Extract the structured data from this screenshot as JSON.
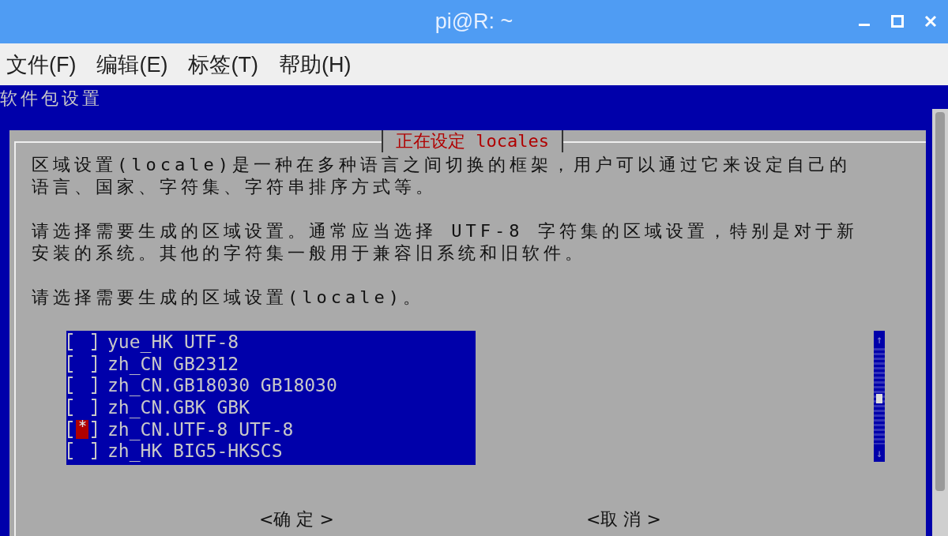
{
  "window": {
    "title": "pi@R: ~"
  },
  "menu": [
    "文件(F)",
    "编辑(E)",
    "标签(T)",
    "帮助(H)"
  ],
  "terminal": {
    "backtitle": "软件包设置"
  },
  "dialog": {
    "title": "正在设定 locales",
    "paragraphs": [
      "区域设置(locale)是一种在多种语言之间切换的框架，用户可以通过它来设定自己的语言、国家、字符集、字符串排序方式等。",
      "请选择需要生成的区域设置。通常应当选择 UTF-8 字符集的区域设置，特别是对于新安装的系统。其他的字符集一般用于兼容旧系统和旧软件。",
      "请选择需要生成的区域设置(locale)。"
    ],
    "items": [
      {
        "label": "yue_HK UTF-8",
        "checked": false
      },
      {
        "label": "zh_CN GB2312",
        "checked": false
      },
      {
        "label": "zh_CN.GB18030 GB18030",
        "checked": false
      },
      {
        "label": "zh_CN.GBK GBK",
        "checked": false
      },
      {
        "label": "zh_CN.UTF-8 UTF-8",
        "checked": true
      },
      {
        "label": "zh_HK BIG5-HKSCS",
        "checked": false
      }
    ],
    "scroll_up": "↑",
    "scroll_down": "↓",
    "buttons": [
      "<确 定 >",
      "<取 消 >"
    ]
  }
}
